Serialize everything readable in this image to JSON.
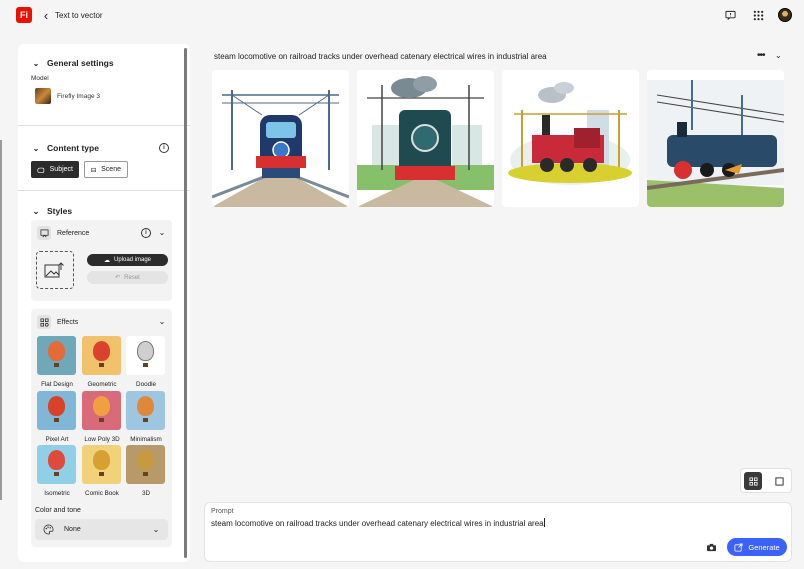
{
  "app": {
    "logo_text": "Fi",
    "title": "Text to vector"
  },
  "header": {
    "icons": [
      "feedback-icon",
      "apps-grid-icon",
      "avatar"
    ]
  },
  "general_settings": {
    "title": "General settings",
    "model_label": "Model",
    "model_name": "Firefly Image 3"
  },
  "content_type": {
    "title": "Content type",
    "options": [
      {
        "label": "Subject",
        "selected": true
      },
      {
        "label": "Scene",
        "selected": false
      }
    ]
  },
  "styles": {
    "title": "Styles",
    "reference": {
      "title": "Reference",
      "upload_label": "Upload image",
      "reset_label": "Reset"
    },
    "effects": {
      "title": "Effects",
      "items": [
        {
          "label": "Flat Design",
          "bg": "#6fa8b8",
          "balloon": "#e36b3a"
        },
        {
          "label": "Geometric",
          "bg": "#f2c16b",
          "balloon": "#d8422e"
        },
        {
          "label": "Doodle",
          "bg": "#ffffff",
          "balloon": "#cfcfcf"
        },
        {
          "label": "Pixel Art",
          "bg": "#7fb7d6",
          "balloon": "#d9422a"
        },
        {
          "label": "Low Poly 3D",
          "bg": "#d86a7a",
          "balloon": "#f0a040"
        },
        {
          "label": "Minimalism",
          "bg": "#9fc6e0",
          "balloon": "#e0883a"
        },
        {
          "label": "Isometric",
          "bg": "#8fd0e8",
          "balloon": "#e04a3a"
        },
        {
          "label": "Comic Book",
          "bg": "#f1d27a",
          "balloon": "#d8a030"
        },
        {
          "label": "3D",
          "bg": "#b89a6a",
          "balloon": "#c89a40"
        }
      ]
    },
    "color_tone": {
      "label": "Color and tone",
      "value": "None"
    }
  },
  "main": {
    "prompt_title": "steam locomotive on railroad tracks under overhead catenary electrical wires in industrial area",
    "results": [
      {
        "name": "result-image-1",
        "bg": "#ffffff"
      },
      {
        "name": "result-image-2",
        "bg": "#ffffff"
      },
      {
        "name": "result-image-3",
        "bg": "#ffffff"
      },
      {
        "name": "result-image-4",
        "bg": "#ffffff"
      }
    ]
  },
  "prompt": {
    "label": "Prompt",
    "text": "steam locomotive on railroad tracks under overhead catenary electrical wires in industrial area",
    "generate_label": "Generate"
  }
}
